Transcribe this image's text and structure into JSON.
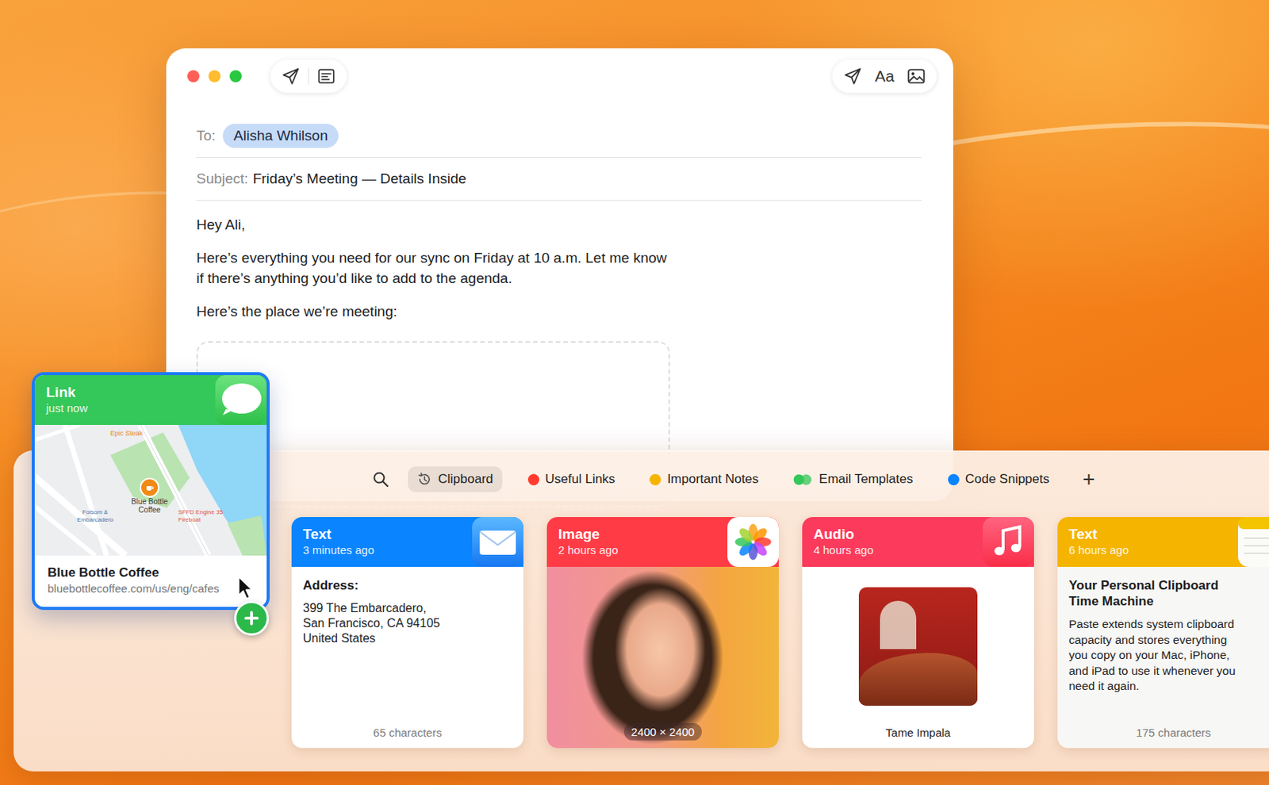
{
  "mail": {
    "to_label": "To:",
    "recipient": "Alisha Whilson",
    "subject_label": "Subject:",
    "subject": "Friday’s Meeting — Details Inside",
    "format_button": "Aa",
    "body": [
      [
        "Hey Ali,"
      ],
      [
        "Here’s everything you need for our sync on Friday at 10 a.m. Let me know",
        "if there’s anything you’d like to add to the agenda."
      ],
      [
        "Here’s the place we’re meeting:"
      ]
    ]
  },
  "dragged_card": {
    "type": "Link",
    "time": "just now",
    "color": "#34c759",
    "title": "Blue Bottle Coffee",
    "url": "bluebottlecoffee.com/us/eng/cafes",
    "map_labels": [
      {
        "text": "Epic Steak",
        "color": "#e8871e"
      },
      {
        "text": "Blue Bottle Coffee",
        "color": "#3a3a3a"
      },
      {
        "text": "Folsom & Embarcadero",
        "color": "#4a6fa5"
      },
      {
        "text": "SFFD Engine 35 Fireboat",
        "color": "#e0524a"
      }
    ]
  },
  "tabs": [
    {
      "label": "Clipboard",
      "kind": "history",
      "selected": true,
      "color": "#555555"
    },
    {
      "label": "Useful Links",
      "kind": "pinboard",
      "selected": false,
      "color": "#ff3b30"
    },
    {
      "label": "Important Notes",
      "kind": "pinboard",
      "selected": false,
      "color": "#f5b400"
    },
    {
      "label": "Email Templates",
      "kind": "shared",
      "selected": false,
      "color": "#34c759"
    },
    {
      "label": "Code Snippets",
      "kind": "pinboard",
      "selected": false,
      "color": "#0a84ff"
    }
  ],
  "add_tab": "+",
  "cards": [
    {
      "kind": "text",
      "type": "Text",
      "time": "3 minutes ago",
      "color": "#0a84ff",
      "heading": [
        "Address:"
      ],
      "lines": [
        "399 The Embarcadero,",
        "San Francisco, CA 94105",
        "United States"
      ],
      "footer": "65 characters"
    },
    {
      "kind": "image",
      "type": "Image",
      "time": "2 hours ago",
      "color": "#ff3b45",
      "heading": [],
      "lines": [],
      "footer": "2400 × 2400"
    },
    {
      "kind": "audio",
      "type": "Audio",
      "time": "4 hours ago",
      "color": "#fb3a5c",
      "heading": [],
      "lines": [],
      "footer": "Tame Impala"
    },
    {
      "kind": "note",
      "type": "Text",
      "time": "6 hours ago",
      "color": "#f5b400",
      "heading": [
        "Your Personal Clipboard",
        "Time Machine"
      ],
      "lines": [
        "Paste extends system clipboard",
        "capacity and stores everything",
        "you copy on your Mac, iPhone,",
        "and iPad to use it whenever you",
        "need it again."
      ],
      "footer": "175 characters"
    }
  ]
}
